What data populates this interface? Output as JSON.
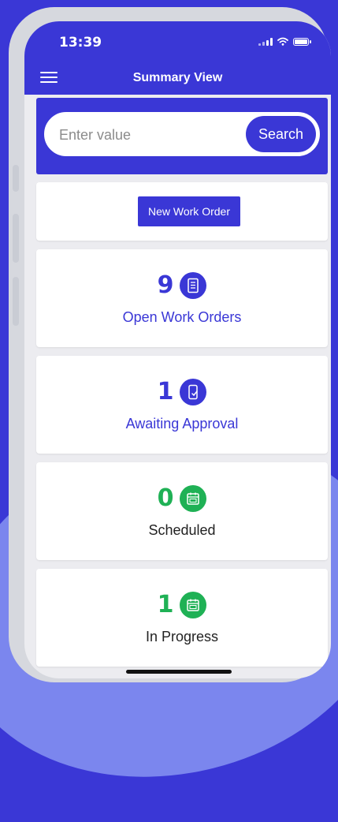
{
  "status_bar": {
    "time": "13:39"
  },
  "header": {
    "title": "Summary View",
    "menu_icon": "hamburger-menu-icon"
  },
  "search": {
    "placeholder": "Enter value",
    "value": "",
    "button_label": "Search"
  },
  "new_order": {
    "label": "New Work Order"
  },
  "stats": [
    {
      "count": "9",
      "label": "Open Work Orders",
      "icon": "checklist-icon",
      "color": "#3a37d6"
    },
    {
      "count": "1",
      "label": "Awaiting Approval",
      "icon": "mobile-check-icon",
      "color": "#3a37d6"
    },
    {
      "count": "0",
      "label": "Scheduled",
      "icon": "calendar-icon",
      "color": "#1fb155"
    },
    {
      "count": "1",
      "label": "In Progress",
      "icon": "calendar-icon",
      "color": "#1fb155"
    }
  ],
  "colors": {
    "primary": "#3a37d6",
    "success": "#1fb155",
    "background": "#ececf0"
  }
}
